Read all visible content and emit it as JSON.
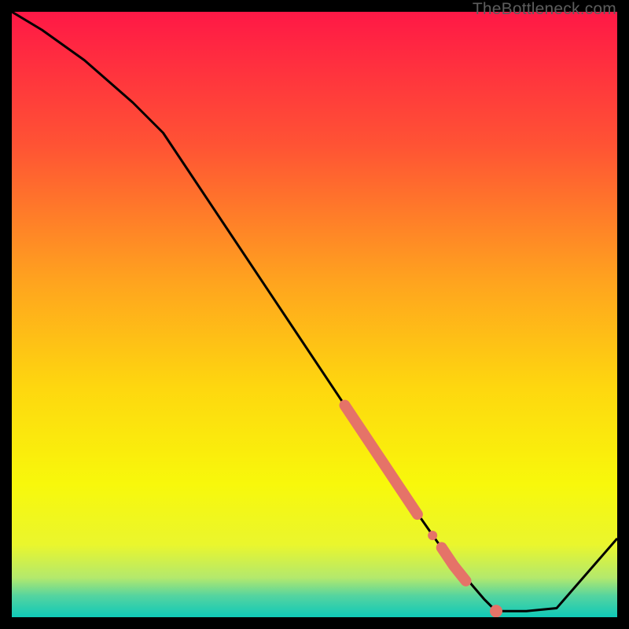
{
  "watermark": "TheBottleneck.com",
  "chart_data": {
    "type": "line",
    "title": "",
    "xlabel": "",
    "ylabel": "",
    "xlim": [
      0,
      100
    ],
    "ylim": [
      0,
      100
    ],
    "background": {
      "kind": "vertical-gradient",
      "stops": [
        {
          "offset": 0.0,
          "color": "#ff1846"
        },
        {
          "offset": 0.22,
          "color": "#ff5334"
        },
        {
          "offset": 0.45,
          "color": "#ffa51e"
        },
        {
          "offset": 0.62,
          "color": "#fed70f"
        },
        {
          "offset": 0.78,
          "color": "#f8f80b"
        },
        {
          "offset": 0.88,
          "color": "#eaf62d"
        },
        {
          "offset": 0.935,
          "color": "#b3e96d"
        },
        {
          "offset": 0.965,
          "color": "#54d4a0"
        },
        {
          "offset": 1.0,
          "color": "#0fc9b8"
        }
      ]
    },
    "series": [
      {
        "name": "bottleneck-curve",
        "color": "#000000",
        "x": [
          0,
          5,
          12,
          20,
          25,
          35,
          45,
          55,
          65,
          72,
          78,
          80,
          85,
          90,
          100
        ],
        "y": [
          100,
          97,
          92,
          85,
          80,
          65,
          50,
          35,
          20,
          10,
          3,
          1,
          1,
          1.5,
          13
        ]
      }
    ],
    "highlights": [
      {
        "name": "highlight-segment-upper",
        "color": "#e57368",
        "thickness": "thick",
        "x": [
          55,
          58,
          61,
          64,
          67
        ],
        "y": [
          35,
          30.5,
          26,
          21.5,
          17
        ]
      },
      {
        "name": "highlight-dot-mid",
        "color": "#e57368",
        "thickness": "dot",
        "x": [
          69.5
        ],
        "y": [
          13.5
        ]
      },
      {
        "name": "highlight-segment-lower",
        "color": "#e57368",
        "thickness": "thick",
        "x": [
          71,
          73,
          75
        ],
        "y": [
          11.5,
          8.5,
          6
        ]
      },
      {
        "name": "highlight-dot-bottom",
        "color": "#e57368",
        "thickness": "large-dot",
        "x": [
          80
        ],
        "y": [
          1
        ]
      }
    ]
  }
}
